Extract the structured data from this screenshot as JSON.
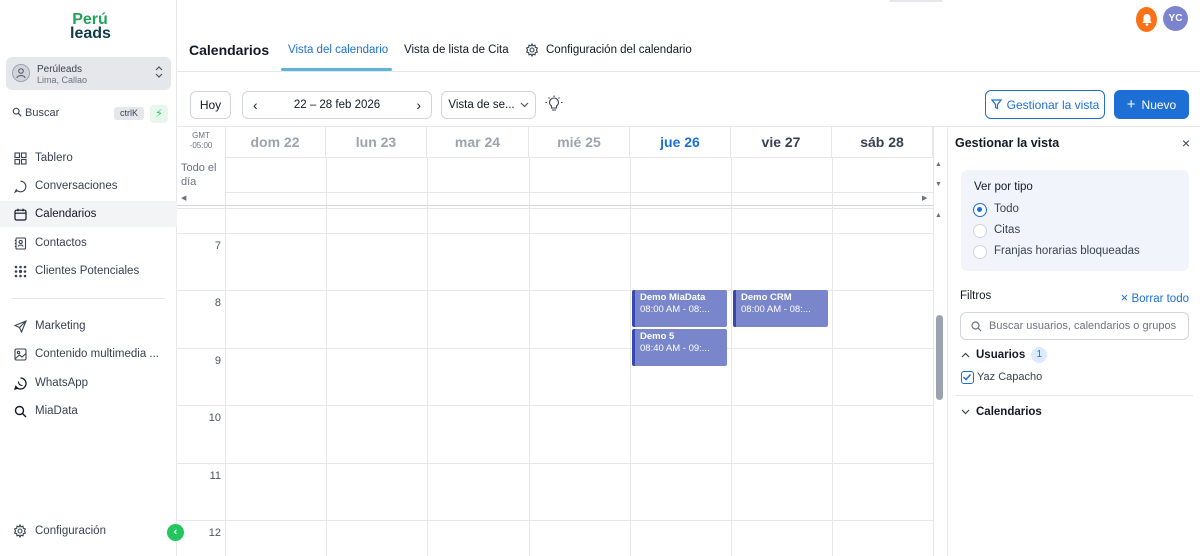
{
  "brand": {
    "line1": "Perú",
    "line2": "leads"
  },
  "account": {
    "name": "Perúleads",
    "location": "Lima, Callao",
    "chevron": "⌃⌄"
  },
  "search": {
    "label": "Buscar",
    "shortcut": "ctrlK",
    "bolt": "⚡"
  },
  "nav": [
    {
      "label": "Tablero",
      "icon": "dashboard-icon"
    },
    {
      "label": "Conversaciones",
      "icon": "chat-icon"
    },
    {
      "label": "Calendarios",
      "icon": "calendar-icon"
    },
    {
      "label": "Contactos",
      "icon": "contacts-icon"
    },
    {
      "label": "Clientes Potenciales",
      "icon": "leads-icon"
    },
    {
      "label": "Marketing",
      "icon": "send-icon"
    },
    {
      "label": "Contenido multimedia ...",
      "icon": "image-icon"
    },
    {
      "label": "WhatsApp",
      "icon": "whatsapp-icon"
    },
    {
      "label": "MiaData",
      "icon": "search-icon"
    }
  ],
  "settings": {
    "label": "Configuración",
    "collapse": "‹"
  },
  "header": {
    "avatar": "YC",
    "title": "Calendarios",
    "tabs": [
      "Vista del calendario",
      "Vista de lista de Cita",
      "Configuración del calendario"
    ]
  },
  "toolbar": {
    "today": "Hoy",
    "prev": "‹",
    "next": "›",
    "range": "22 – 28 feb 2026",
    "view": "Vista de se...",
    "manage": "Gestionar la vista",
    "new": "Nuevo",
    "plus": "+"
  },
  "calendar": {
    "timezone": [
      "GMT",
      "-05:00"
    ],
    "allday": "Todo el día",
    "days": [
      {
        "label": "dom 22",
        "state": "past"
      },
      {
        "label": "lun 23",
        "state": "past"
      },
      {
        "label": "mar 24",
        "state": "past"
      },
      {
        "label": "mié 25",
        "state": "past"
      },
      {
        "label": "jue 26",
        "state": "today"
      },
      {
        "label": "vie 27",
        "state": "future"
      },
      {
        "label": "sáb 28",
        "state": "future"
      }
    ],
    "hours": [
      "7",
      "8",
      "9",
      "10",
      "11",
      "12"
    ],
    "events": [
      {
        "title": "Demo MiaData",
        "time": "08:00 AM - 08:...",
        "day": 4
      },
      {
        "title": "Demo 5",
        "time": "08:40 AM - 09:...",
        "day": 4
      },
      {
        "title": "Demo CRM",
        "time": "08:00 AM - 08:...",
        "day": 5
      }
    ]
  },
  "panel": {
    "title": "Gestionar la vista",
    "close": "×",
    "by_type": "Ver por tipo",
    "options": [
      "Todo",
      "Citas",
      "Franjas horarias bloqueadas"
    ],
    "selected": "Todo",
    "filters": "Filtros",
    "clear_all": "Borrar todo",
    "clear_icon": "×",
    "search_placeholder": "Buscar usuarios, calendarios o grupos",
    "users_label": "Usuarios",
    "users_count": "1",
    "user": "Yaz Capacho",
    "calendars_label": "Calendarios",
    "caret_up": "⌃",
    "caret_down": "⌄"
  }
}
